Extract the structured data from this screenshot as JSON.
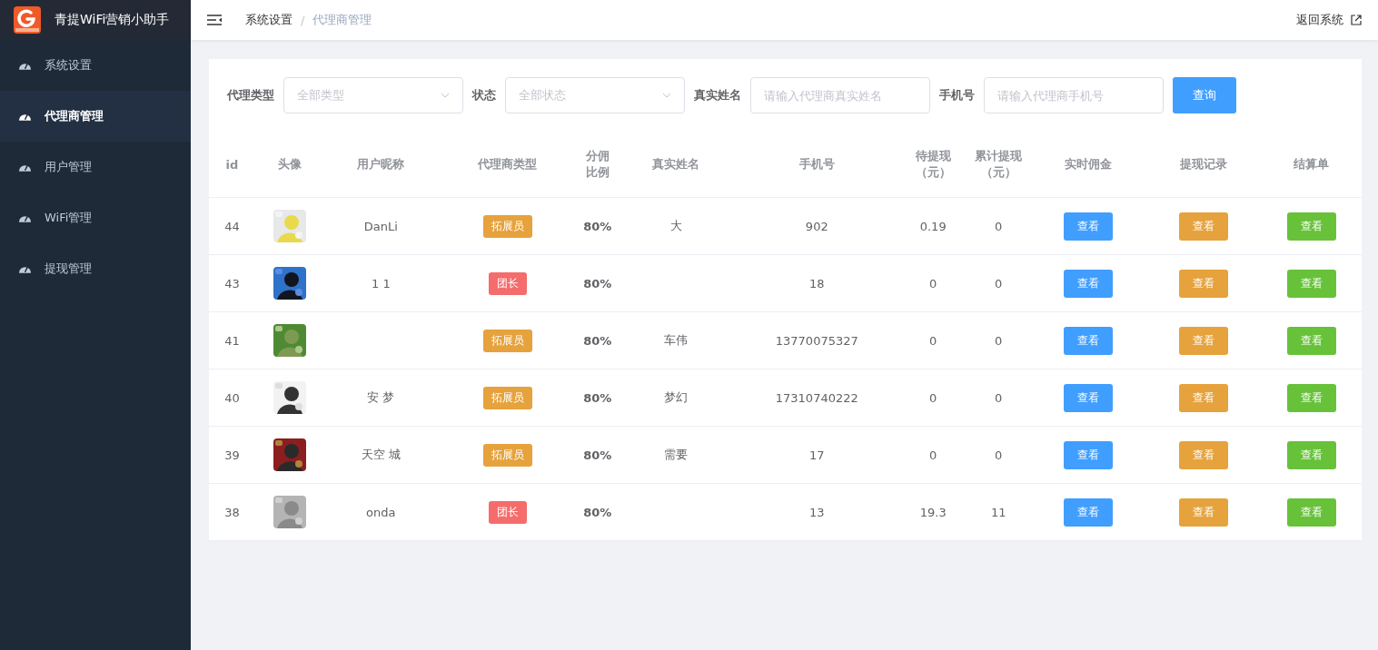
{
  "app": {
    "title": "青提WiFi营销小助手"
  },
  "sidebar": {
    "items": [
      {
        "label": "系统设置",
        "selected": false
      },
      {
        "label": "代理商管理",
        "selected": true
      },
      {
        "label": "用户管理",
        "selected": false
      },
      {
        "label": "WiFi管理",
        "selected": false
      },
      {
        "label": "提现管理",
        "selected": false
      }
    ]
  },
  "breadcrumb": [
    "系统设置",
    "/",
    "代理商管理"
  ],
  "header_link": "返回系统",
  "filters": [
    {
      "kind": "select",
      "label": "代理类型",
      "placeholder": "全部类型"
    },
    {
      "kind": "select",
      "label": "状态",
      "placeholder": "全部状态"
    },
    {
      "kind": "input",
      "label": "真实姓名",
      "placeholder": "请输入代理商真实姓名"
    },
    {
      "kind": "input",
      "label": "手机号",
      "placeholder": "请输入代理商手机号"
    }
  ],
  "query_button": "查询",
  "table": {
    "columns": [
      "id",
      "头像",
      "用户昵称",
      "代理商类型",
      "分佣比例",
      "真实姓名",
      "手机号",
      "待提现（元）",
      "累计提现（元）",
      "实时佣金",
      "提现记录",
      "结算单"
    ],
    "rows": [
      {
        "id": "44",
        "avatar": {
          "kind": "picture"
        },
        "nickname": "DanLi",
        "type": {
          "label": "拓展员",
          "color": "#e6a23c"
        },
        "ratio": "80%",
        "real_name": "大",
        "phone": "902",
        "pending": "0.19",
        "total": "0",
        "actions": [
          "查看",
          "查看",
          "查看"
        ]
      },
      {
        "id": "43",
        "avatar": {
          "kind": "picture"
        },
        "nickname": "1 1",
        "type": {
          "label": "团长",
          "color": "#f56c6c"
        },
        "ratio": "80%",
        "phone": "18",
        "pending": "0",
        "total": "0",
        "actions": [
          "查看",
          "查看",
          "查看"
        ]
      },
      {
        "id": "41",
        "avatar": {
          "kind": "picture"
        },
        "type": {
          "label": "拓展员",
          "color": "#e6a23c"
        },
        "ratio": "80%",
        "real_name": "车伟",
        "phone": "13770075327",
        "pending": "0",
        "total": "0",
        "actions": [
          "查看",
          "查看",
          "查看"
        ]
      },
      {
        "id": "40",
        "avatar": {
          "kind": "picture"
        },
        "nickname": "安 梦",
        "type": {
          "label": "拓展员",
          "color": "#e6a23c"
        },
        "ratio": "80%",
        "real_name": "梦幻",
        "phone": "17310740222",
        "pending": "0",
        "total": "0",
        "actions": [
          "查看",
          "查看",
          "查看"
        ]
      },
      {
        "id": "39",
        "avatar": {
          "kind": "picture"
        },
        "nickname": "天空 城",
        "type": {
          "label": "拓展员",
          "color": "#e6a23c"
        },
        "ratio": "80%",
        "real_name": "需要",
        "phone": "17",
        "pending": "0",
        "total": "0",
        "actions": [
          "查看",
          "查看",
          "查看"
        ]
      },
      {
        "id": "38",
        "avatar": {
          "kind": "picture"
        },
        "nickname": "onda",
        "type": {
          "label": "团长",
          "color": "#f56c6c"
        },
        "ratio": "80%",
        "phone": "13",
        "pending": "19.3",
        "total": "11",
        "actions": [
          "查看",
          "查看",
          "查看"
        ]
      }
    ]
  }
}
